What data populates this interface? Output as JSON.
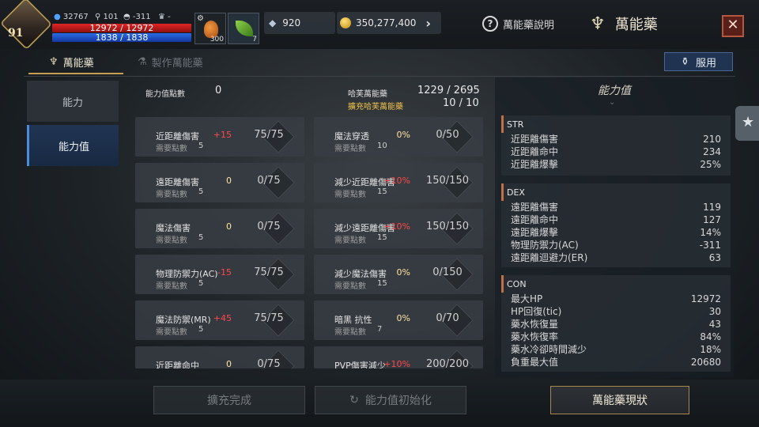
{
  "player": {
    "level": "91",
    "exp": "32767",
    "keys": "101",
    "helmet": "-311",
    "trophy": "-",
    "hp": "12972 / 12972",
    "mp": "1838 / 1838"
  },
  "slots": [
    {
      "icon": "potion-icon",
      "count": "300"
    },
    {
      "icon": "leaf-icon",
      "count": "7"
    }
  ],
  "currency": {
    "gems": "920",
    "gold": "350,277,400"
  },
  "header": {
    "help_label": "萬能藥說明",
    "title": "萬能藥"
  },
  "tabs": [
    {
      "label": "萬能藥"
    },
    {
      "label": "製作萬能藥"
    }
  ],
  "use_button": "服用",
  "nav": [
    {
      "label": "能力"
    },
    {
      "label": "能力值"
    }
  ],
  "summary": {
    "points_label": "能力值點數",
    "points_value": "0",
    "elixir_label": "哈芙萬能藥",
    "elixir_value": "1229 / 2695",
    "expand_label": "擴充哈芙萬能藥",
    "expand_value": "10 / 10"
  },
  "need_label": "需要點數",
  "cards_left": [
    {
      "name": "近距離傷害",
      "bonus": "+15",
      "need": "5",
      "progress": "75/75"
    },
    {
      "name": "遠距離傷害",
      "bonus": "0",
      "need": "5",
      "progress": "0/75"
    },
    {
      "name": "魔法傷害",
      "bonus": "0",
      "need": "5",
      "progress": "0/75"
    },
    {
      "name": "物理防禦力(AC)",
      "bonus": "-15",
      "need": "5",
      "progress": "75/75"
    },
    {
      "name": "魔法防禦(MR)",
      "bonus": "+45",
      "need": "5",
      "progress": "75/75"
    },
    {
      "name": "近距離命中",
      "bonus": "0",
      "need": "5",
      "progress": "0/75"
    }
  ],
  "cards_right": [
    {
      "name": "魔法穿透",
      "bonus": "0%",
      "need": "10",
      "progress": "0/50"
    },
    {
      "name": "減少近距離傷害",
      "bonus": "+10%",
      "need": "15",
      "progress": "150/150"
    },
    {
      "name": "減少遠距離傷害",
      "bonus": "+10%",
      "need": "15",
      "progress": "150/150"
    },
    {
      "name": "減少魔法傷害",
      "bonus": "0%",
      "need": "15",
      "progress": "0/150"
    },
    {
      "name": "暗黑 抗性",
      "bonus": "0%",
      "need": "7",
      "progress": "0/70"
    },
    {
      "name": "PVP傷害減少",
      "bonus": "+10%",
      "need": "20",
      "progress": "200/200"
    }
  ],
  "panel": {
    "title": "能力值",
    "sections": [
      {
        "head": "STR",
        "rows": [
          [
            "近距離傷害",
            "210"
          ],
          [
            "近距離命中",
            "234"
          ],
          [
            "近距離爆擊",
            "25%"
          ]
        ]
      },
      {
        "head": "DEX",
        "rows": [
          [
            "遠距離傷害",
            "119"
          ],
          [
            "遠距離命中",
            "127"
          ],
          [
            "遠距離爆擊",
            "14%"
          ],
          [
            "物理防禦力(AC)",
            "-311"
          ],
          [
            "遠距離迴避力(ER)",
            "63"
          ]
        ]
      },
      {
        "head": "CON",
        "rows": [
          [
            "最大HP",
            "12972"
          ],
          [
            "HP回復(tic)",
            "30"
          ],
          [
            "藥水恢復量",
            "43"
          ],
          [
            "藥水恢復率",
            "84%"
          ],
          [
            "藥水冷卻時間減少",
            "18%"
          ],
          [
            "負重最大值",
            "20680"
          ]
        ]
      }
    ]
  },
  "buttons": {
    "expand_done": "擴充完成",
    "reset": "能力值初始化",
    "status": "萬能藥現狀"
  },
  "colors": {
    "accent": "#c79f53",
    "red": "#ff4848",
    "nav_active": "#4c8cdf"
  }
}
